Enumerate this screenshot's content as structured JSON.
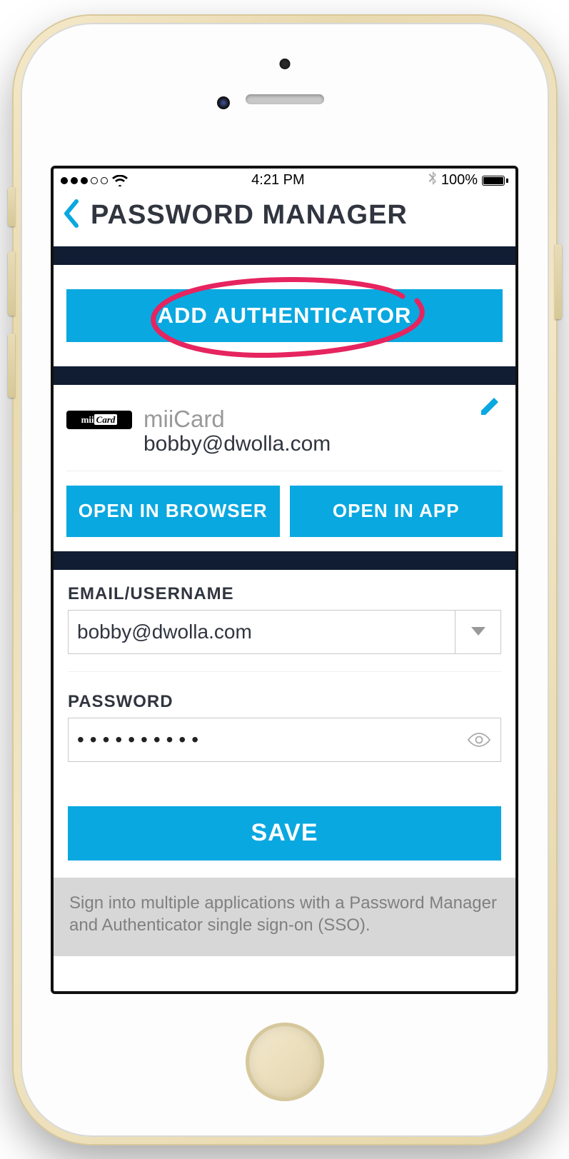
{
  "status_bar": {
    "time": "4:21 PM",
    "battery_pct": "100%"
  },
  "nav": {
    "title": "PASSWORD MANAGER"
  },
  "buttons": {
    "add_authenticator": "ADD AUTHENTICATOR",
    "open_browser": "OPEN IN BROWSER",
    "open_app": "OPEN IN APP",
    "save": "SAVE"
  },
  "account": {
    "logo_text": "miiCard",
    "service_name": "miiCard",
    "email_display": "bobby@dwolla.com"
  },
  "form": {
    "email_label": "EMAIL/USERNAME",
    "email_value": "bobby@dwolla.com",
    "password_label": "PASSWORD",
    "password_value": "••••••••••"
  },
  "footer": {
    "text": "Sign into multiple applications with a Password Manager and Authenticator single sign-on (SSO)."
  }
}
